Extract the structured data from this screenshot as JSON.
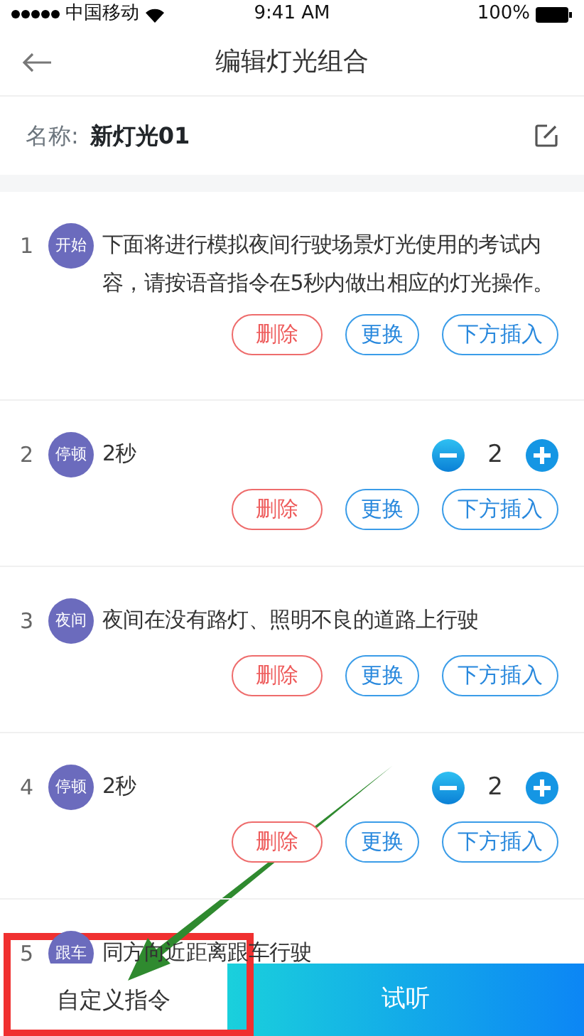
{
  "status_bar": {
    "carrier": "中国移动",
    "time": "9:41 AM",
    "battery": "100%"
  },
  "header": {
    "title": "编辑灯光组合"
  },
  "name_row": {
    "label": "名称:",
    "value": "新灯光01"
  },
  "steps": [
    {
      "number": "1",
      "badge": "开始",
      "text": "下面将进行模拟夜间行驶场景灯光使用的考试内容，请按语音指令在5秒内做出相应的灯光操作。",
      "actions": [
        {
          "label": "删除",
          "kind": "danger"
        },
        {
          "label": "更换",
          "kind": "normal"
        },
        {
          "label": "下方插入",
          "kind": "normal"
        }
      ]
    },
    {
      "number": "2",
      "badge": "停顿",
      "text": "2秒",
      "stepper": {
        "value": "2"
      },
      "actions": [
        {
          "label": "删除",
          "kind": "danger"
        },
        {
          "label": "更换",
          "kind": "normal"
        },
        {
          "label": "下方插入",
          "kind": "normal"
        }
      ]
    },
    {
      "number": "3",
      "badge": "夜间",
      "text": "夜间在没有路灯、照明不良的道路上行驶",
      "actions": [
        {
          "label": "删除",
          "kind": "danger"
        },
        {
          "label": "更换",
          "kind": "normal"
        },
        {
          "label": "下方插入",
          "kind": "normal"
        }
      ]
    },
    {
      "number": "4",
      "badge": "停顿",
      "text": "2秒",
      "stepper": {
        "value": "2"
      },
      "actions": [
        {
          "label": "删除",
          "kind": "danger"
        },
        {
          "label": "更换",
          "kind": "normal"
        },
        {
          "label": "下方插入",
          "kind": "normal"
        }
      ]
    },
    {
      "number": "5",
      "badge": "跟车",
      "text": "同方向近距离跟车行驶"
    }
  ],
  "bottom_bar": {
    "custom_button": "自定义指令",
    "listen_button": "试听"
  }
}
